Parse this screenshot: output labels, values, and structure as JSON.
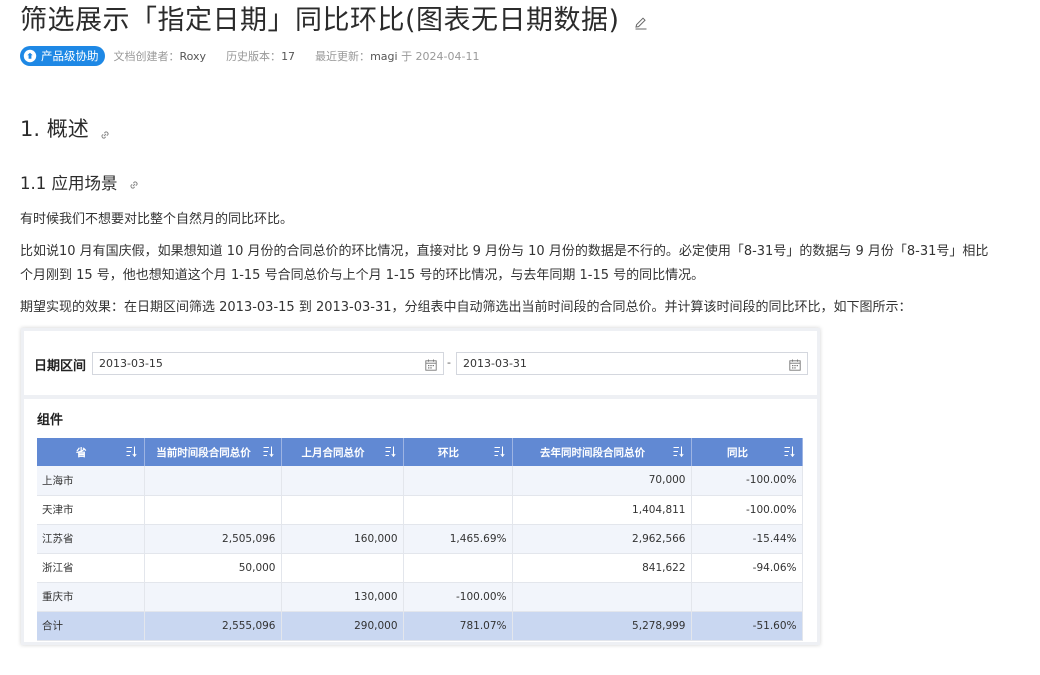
{
  "header": {
    "title": "筛选展示「指定日期」同比环比(图表无日期数据)",
    "badge": "产品级协助",
    "creator_label": "文档创建者：",
    "creator": "Roxy",
    "version_label": "历史版本：",
    "version": "17",
    "updated_label": "最近更新：",
    "updated_by": "magi",
    "updated_on": "于 2024-04-11"
  },
  "sections": {
    "h2": "1. 概述",
    "h3": "1.1 应用场景"
  },
  "paragraphs": {
    "p1": "有时候我们不想要对比整个自然月的同比环比。",
    "p2_line1": "比如说10 月有国庆假，如果想知道 10 月份的合同总价的环比情况，直接对比 9 月份与 10 月份的数据是不行的。必定使用「8-31号」的数据与 9 月份「8-31号」相比",
    "p2_line2": "个月刚到 15 号，他也想知道这个月 1-15 号合同总价与上个月 1-15 号的环比情况，与去年同期 1-15 号的同比情况。",
    "p3": "期望实现的效果：在日期区间筛选 2013-03-15 到 2013-03-31，分组表中自动筛选出当前时间段的合同总价。并计算该时间段的同比环比，如下图所示："
  },
  "filter": {
    "label": "日期区间",
    "start": "2013-03-15",
    "separator": "-",
    "end": "2013-03-31"
  },
  "component": {
    "title": "组件",
    "columns": [
      "省",
      "当前时间段合同总价",
      "上月合同总价",
      "环比",
      "去年同时间段合同总价",
      "同比"
    ],
    "rows": [
      [
        "上海市",
        "",
        "",
        "",
        "70,000",
        "-100.00%"
      ],
      [
        "天津市",
        "",
        "",
        "",
        "1,404,811",
        "-100.00%"
      ],
      [
        "江苏省",
        "2,505,096",
        "160,000",
        "1,465.69%",
        "2,962,566",
        "-15.44%"
      ],
      [
        "浙江省",
        "50,000",
        "",
        "",
        "841,622",
        "-94.06%"
      ],
      [
        "重庆市",
        "",
        "130,000",
        "-100.00%",
        "",
        ""
      ],
      [
        "合计",
        "2,555,096",
        "290,000",
        "781.07%",
        "5,278,999",
        "-51.60%"
      ]
    ]
  },
  "icons": {
    "edit": "pencil-icon",
    "badge": "help-circle-icon",
    "anchor": "link-icon",
    "calendar": "calendar-icon",
    "sort": "sort-icon"
  },
  "colors": {
    "badge": "#1e88e5",
    "table_header": "#6189d3",
    "total_row": "#c9d7f1"
  }
}
